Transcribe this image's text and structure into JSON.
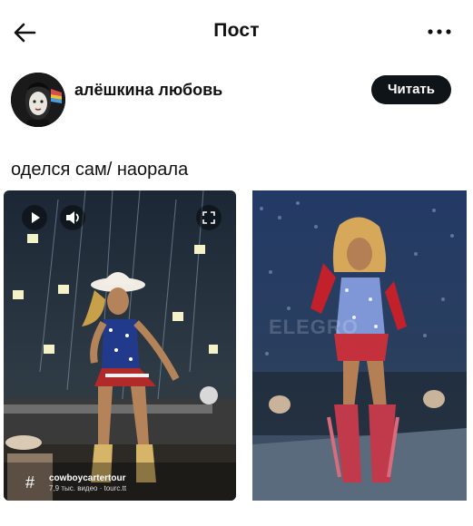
{
  "header": {
    "title": "Пост"
  },
  "author": {
    "name": "алёшкина любовь",
    "follow_label": "Читать"
  },
  "post": {
    "text": "оделся сам/ наорала"
  },
  "media": {
    "left": {
      "tag": "cowboycartertour",
      "sub": "7,9 тыс. видео · tourc.tt"
    },
    "right": {
      "watermark": "ELEGRO"
    }
  },
  "colors": {
    "follow_bg": "#0f1419",
    "text": "#111111"
  }
}
